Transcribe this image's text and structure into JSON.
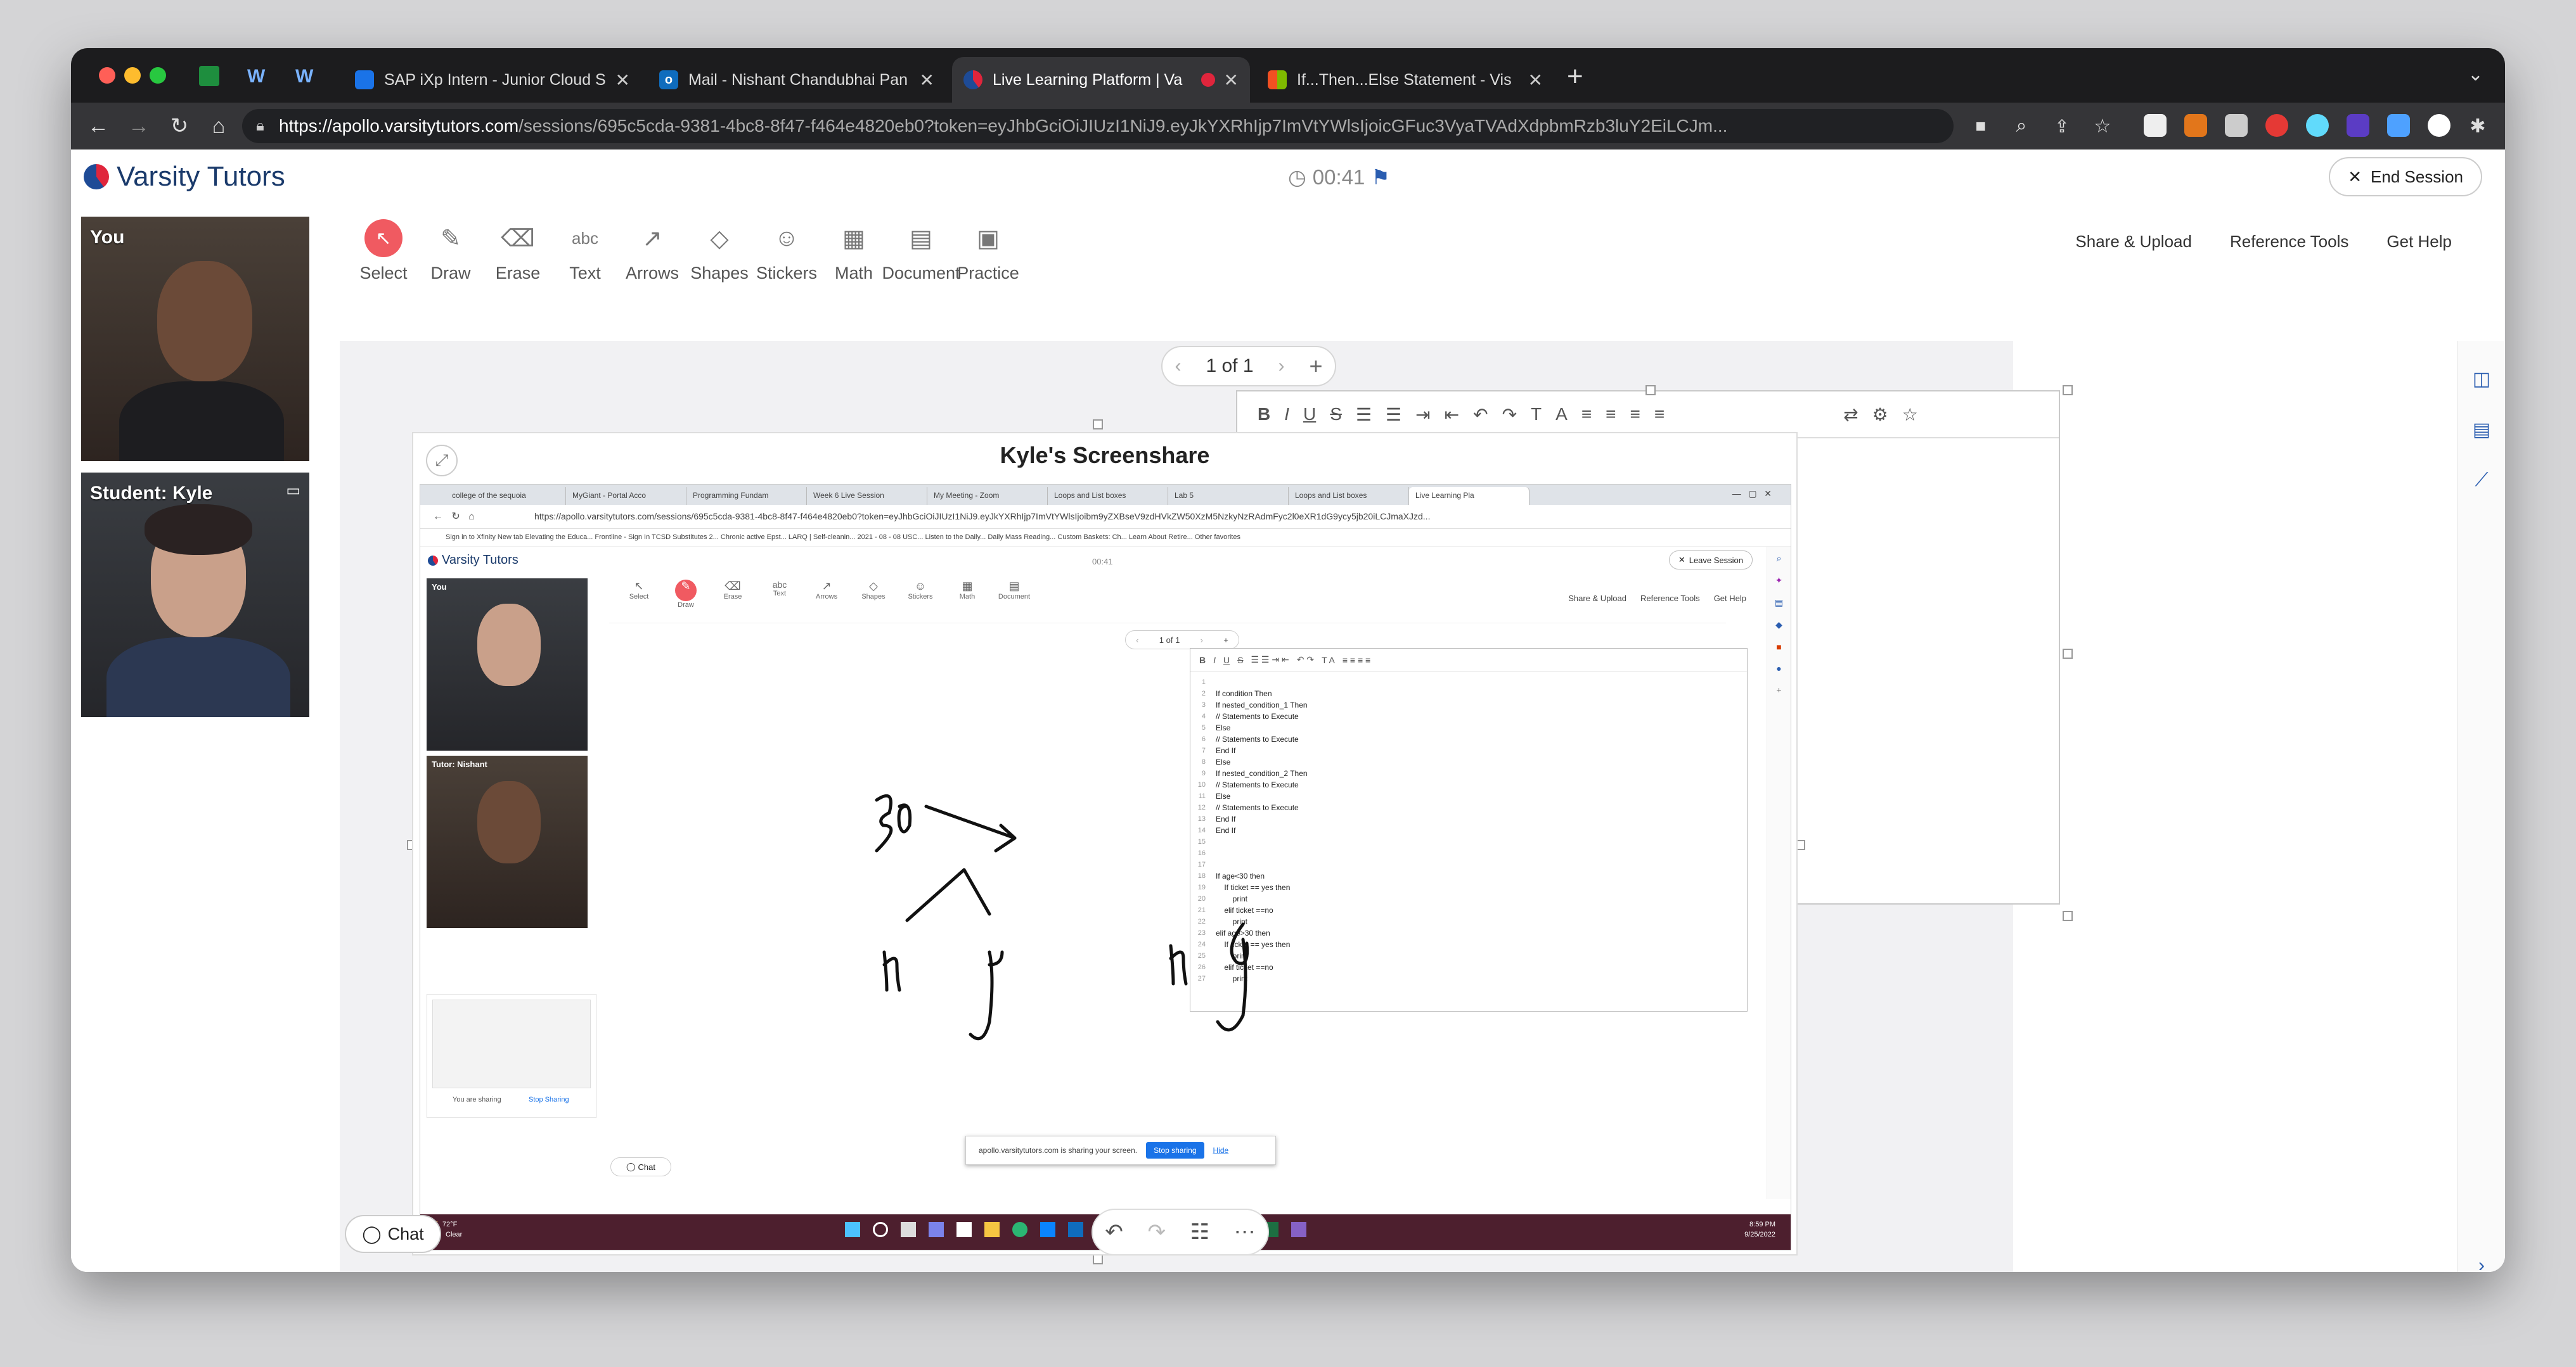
{
  "browser": {
    "tabs": [
      {
        "title": "SAP iXp Intern - Junior Cloud S",
        "active": false
      },
      {
        "title": "Mail - Nishant Chandubhai Pan",
        "active": false
      },
      {
        "title": "Live Learning Platform | Va",
        "active": true
      },
      {
        "title": "If...Then...Else Statement - Vis",
        "active": false
      }
    ],
    "url_host": "https://apollo.varsitytutors.com",
    "url_path": "/sessions/695c5cda-9381-4bc8-8f47-f464e4820eb0?token=eyJhbGciOiJIUzI1NiJ9.eyJkYXRhIjp7ImVtYWlsIjoicGFuc3VyaTVAdXdpbmRzb3luY2EiLCJm..."
  },
  "header": {
    "brand": "Varsity Tutors",
    "timer": "00:41",
    "end_session": "End Session"
  },
  "videos": {
    "you_label": "You",
    "student_label": "Student: Kyle"
  },
  "toolbar": {
    "tools": [
      "Select",
      "Draw",
      "Erase",
      "Text",
      "Arrows",
      "Shapes",
      "Stickers",
      "Math",
      "Document",
      "Practice"
    ],
    "right_links": [
      "Share & Upload",
      "Reference Tools",
      "Get Help"
    ]
  },
  "pager": {
    "label": "1 of 1"
  },
  "screenshare": {
    "title": "Kyle's Screenshare",
    "inner_tabs": [
      "college of the sequoia",
      "MyGiant - Portal Acco",
      "Programming Fundam",
      "Week 6 Live Session",
      "My Meeting - Zoom",
      "Loops and List boxes",
      "Lab 5",
      "Loops and List boxes",
      "Live Learning Pla"
    ],
    "inner_url": "https://apollo.varsitytutors.com/sessions/695c5cda-9381-4bc8-8f47-f464e4820eb0?token=eyJhbGciOiJIUzI1NiJ9.eyJkYXRhIjp7ImVtYWlsIjoibm9yZXBseV9zdHVkZW50XzM5NzkyNzRAdmFyc2l0eXR1dG9ycy5jb20iLCJmaXJzd...",
    "bookmarks": "Sign in to Xfinity   New tab   Elevating the Educa...   Frontline - Sign In   TCSD Substitutes 2...   Chronic active Epst...   LARQ | Self-cleanin...   2021 - 08 - 08 USC...   Listen to the Daily...   Daily Mass Reading...   Custom Baskets: Ch...   Learn About Retire...   Other favorites",
    "inner_brand": "Varsity Tutors",
    "inner_timer": "00:41",
    "leave_session": "Leave Session",
    "inner_tools": [
      "Select",
      "Draw",
      "Erase",
      "Text",
      "Arrows",
      "Shapes",
      "Stickers",
      "Math",
      "Document"
    ],
    "inner_links": [
      "Share & Upload",
      "Reference Tools",
      "Get Help"
    ],
    "inner_you": "You",
    "inner_tutor": "Tutor: Nishant",
    "inner_pager": "1 of 1",
    "code_lines": [
      "",
      "If condition Then",
      "If nested_condition_1 Then",
      "// Statements to Execute",
      "Else",
      "// Statements to Execute",
      "End If",
      "Else",
      "If nested_condition_2 Then",
      "// Statements to Execute",
      "Else",
      "// Statements to Execute",
      "End If",
      "End If",
      "",
      "",
      "",
      "If age<30 then",
      "    If ticket == yes then",
      "        print",
      "    elif ticket ==no",
      "        print",
      "elif age>30 then",
      "    If ticket == yes then",
      "        print",
      "    elif ticket ==no",
      "        print"
    ],
    "handwriting": [
      "30",
      "n",
      "y",
      "n",
      "y"
    ],
    "sharing_text": "apollo.varsitytutors.com is sharing your screen.",
    "stop_sharing": "Stop sharing",
    "hide": "Hide",
    "you_are_sharing": "You are sharing",
    "stop_sharing_thumb": "Stop Sharing",
    "inner_chat": "Chat",
    "weather_temp": "72°F",
    "weather_cond": "Clear",
    "clock_time": "8:59 PM",
    "clock_date": "9/25/2022"
  },
  "chat": {
    "label": "Chat"
  }
}
